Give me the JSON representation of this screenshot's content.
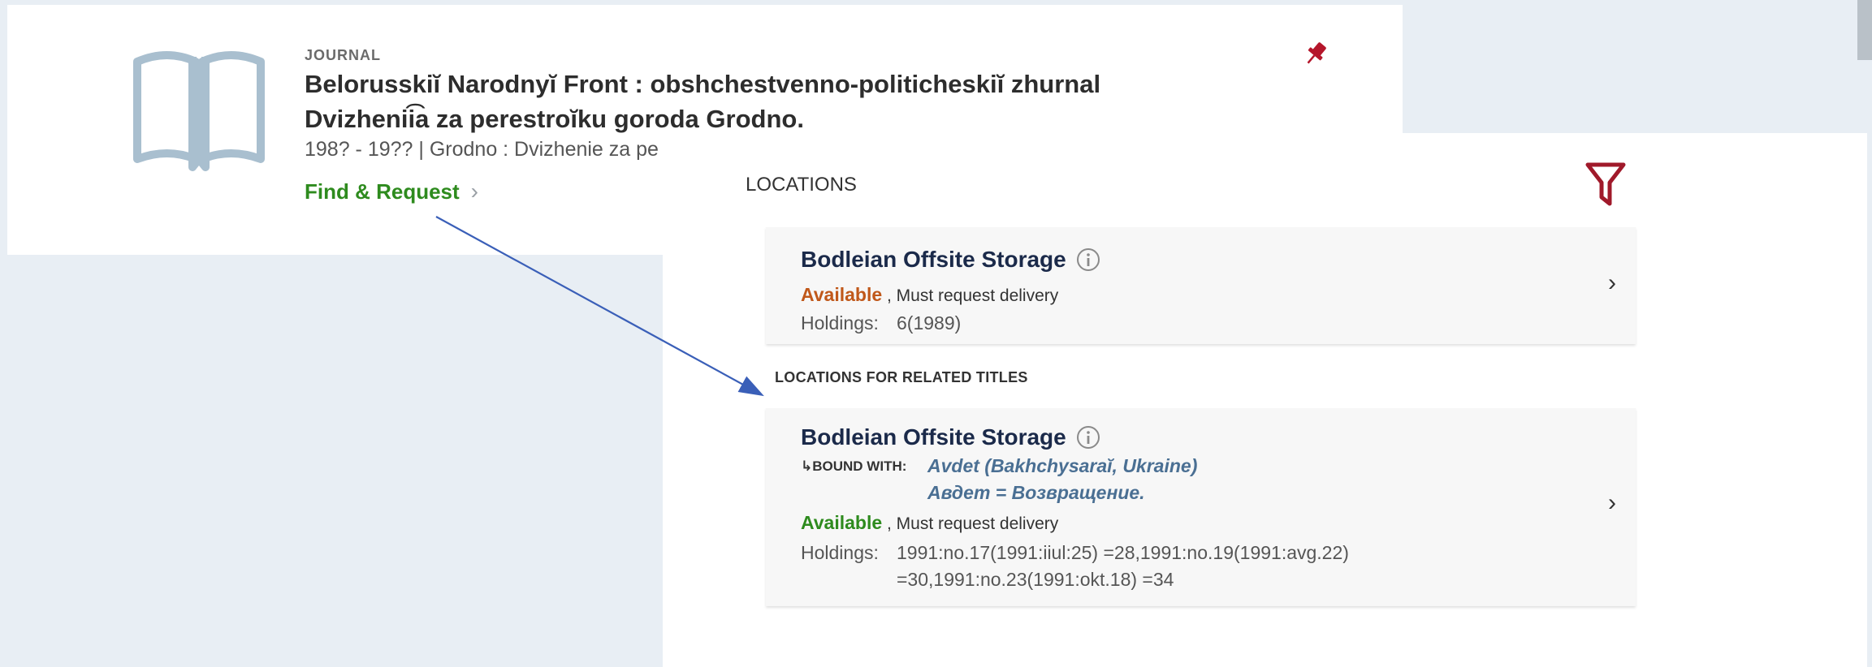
{
  "record": {
    "type": "JOURNAL",
    "title_line1": "Belorusskiĭ Narodnyĭ Front : obshchestvenno-politicheskiĭ zhurnal",
    "title_line2": "Dvizhenii͡a za perestroĭku goroda Grodno.",
    "meta": "198? - 19?? | Grodno : Dvizhenie za pe",
    "find_request_label": "Find & Request",
    "icons": {
      "book": "book-icon",
      "pin": "pin-icon",
      "chevron": "chevron-right-icon"
    }
  },
  "locations": {
    "heading": "LOCATIONS",
    "filter_icon": "filter-icon",
    "items": [
      {
        "library": "Bodleian Offsite Storage",
        "status": "Available",
        "status_suffix": ", Must request delivery",
        "holdings_label": "Holdings:",
        "holdings_value": "6(1989)"
      }
    ]
  },
  "related": {
    "heading": "LOCATIONS FOR RELATED TITLES",
    "items": [
      {
        "library": "Bodleian Offsite Storage",
        "bound_with_label": "↳BOUND WITH:",
        "bound_with_line1": "Avdet (Bakhchysaraĭ, Ukraine)",
        "bound_with_line2": "Авдет = Возвращение.",
        "status": "Available",
        "status_suffix": ", Must request delivery",
        "holdings_label": "Holdings:",
        "holdings_line1": "1991:no.17(1991:iiul:25) =28,1991:no.19(1991:avg.22)",
        "holdings_line2": "=30,1991:no.23(1991:okt.18) =34"
      }
    ]
  },
  "colors": {
    "available_orange": "#c0581a",
    "available_green": "#2e8b1e",
    "find_request": "#2e8b1e",
    "library_name": "#1b2a4a",
    "accent_red": "#a0192a",
    "arrow": "#3a5fb8",
    "link": "#4a6f93"
  }
}
